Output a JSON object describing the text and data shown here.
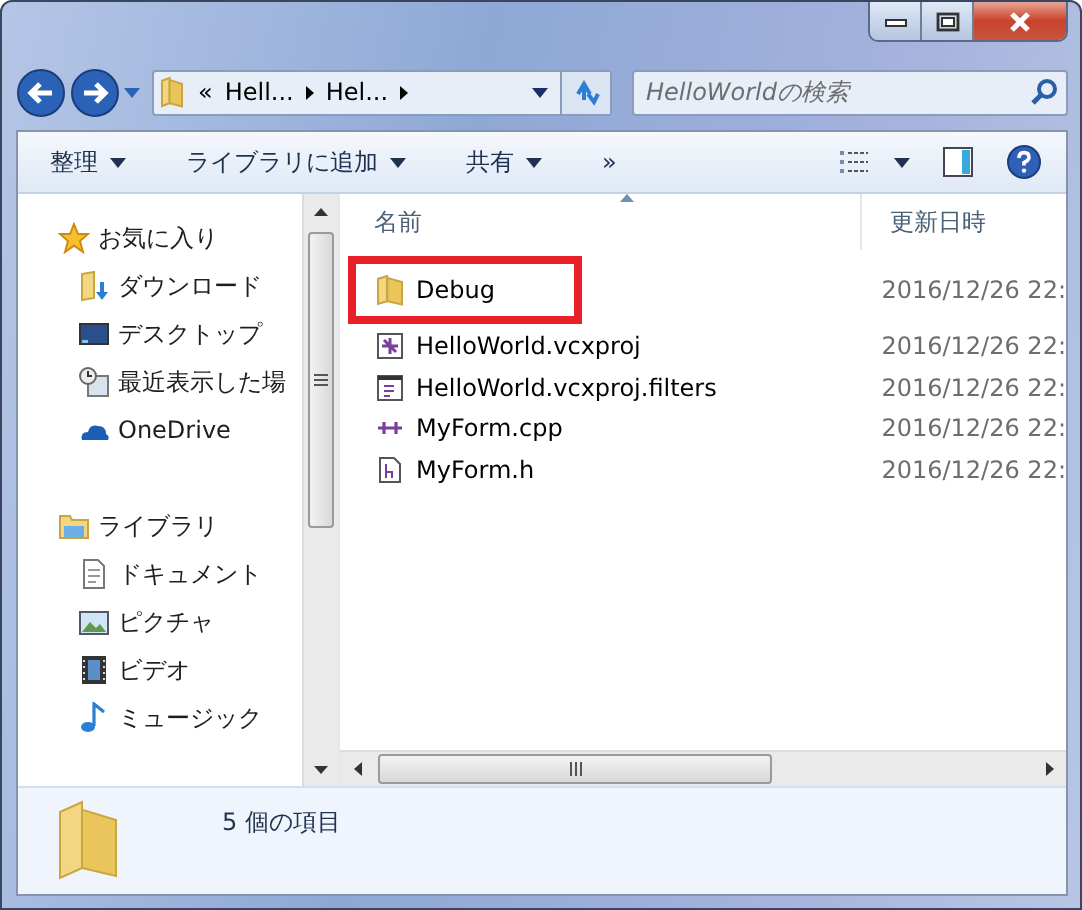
{
  "window": {
    "controls": [
      {
        "kind": "minimize"
      },
      {
        "kind": "maximize"
      },
      {
        "kind": "close"
      }
    ]
  },
  "address_bar": {
    "segments": [
      {
        "text": "«",
        "kind": "overflow"
      },
      {
        "text": "Hell...",
        "kind": "crumb"
      },
      {
        "text": "Hel...",
        "kind": "crumb"
      }
    ]
  },
  "search": {
    "placeholder": "HelloWorldの検索"
  },
  "toolbar": {
    "items": [
      {
        "label": "整理",
        "dropdown": true
      },
      {
        "label": "ライブラリに追加",
        "dropdown": true
      },
      {
        "label": "共有",
        "dropdown": true
      },
      {
        "label": "»",
        "dropdown": false
      }
    ]
  },
  "sidebar": {
    "groups": [
      {
        "label": "お気に入り",
        "kind": "star",
        "children": [
          {
            "label": "ダウンロード",
            "kind": "download"
          },
          {
            "label": "デスクトップ",
            "kind": "desktop"
          },
          {
            "label": "最近表示した場",
            "kind": "recent"
          },
          {
            "label": "OneDrive",
            "kind": "cloud"
          }
        ]
      },
      {
        "label": "ライブラリ",
        "kind": "library",
        "children": [
          {
            "label": "ドキュメント",
            "kind": "document"
          },
          {
            "label": "ピクチャ",
            "kind": "picture"
          },
          {
            "label": "ビデオ",
            "kind": "video"
          },
          {
            "label": "ミュージック",
            "kind": "music"
          }
        ]
      }
    ]
  },
  "table": {
    "columns": [
      "名前",
      "更新日時"
    ],
    "rows": [
      {
        "name": "Debug",
        "kind": "folder",
        "modified": "2016/12/26 22:",
        "highlighted": true
      },
      {
        "name": "HelloWorld.vcxproj",
        "kind": "project",
        "modified": "2016/12/26 22:",
        "highlighted": false
      },
      {
        "name": "HelloWorld.vcxproj.filters",
        "kind": "filters",
        "modified": "2016/12/26 22:",
        "highlighted": false
      },
      {
        "name": "MyForm.cpp",
        "kind": "cpp",
        "modified": "2016/12/26 22:",
        "highlighted": false
      },
      {
        "name": "MyForm.h",
        "kind": "header",
        "modified": "2016/12/26 22:",
        "highlighted": false
      }
    ]
  },
  "status_bar": {
    "text": "5 個の項目"
  }
}
